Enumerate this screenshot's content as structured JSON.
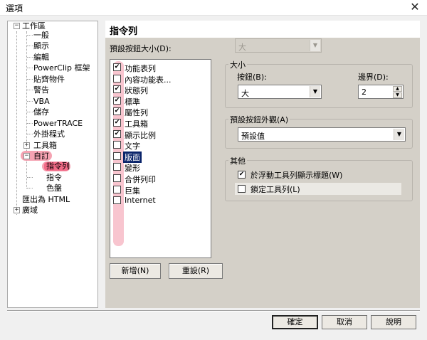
{
  "window": {
    "title": "選項",
    "close_glyph": "✕"
  },
  "tree": {
    "items": [
      {
        "label": "工作區",
        "expander": "-"
      },
      {
        "label": "一般"
      },
      {
        "label": "顯示"
      },
      {
        "label": "編輯"
      },
      {
        "label": "PowerClip 框架"
      },
      {
        "label": "貼齊物件"
      },
      {
        "label": "警告"
      },
      {
        "label": "VBA"
      },
      {
        "label": "儲存"
      },
      {
        "label": "PowerTRACE"
      },
      {
        "label": "外掛程式"
      },
      {
        "label": "工具箱",
        "expander": "+"
      },
      {
        "label": "自訂",
        "expander": "-"
      },
      {
        "label": "指令列"
      },
      {
        "label": "指令"
      },
      {
        "label": "色盤"
      },
      {
        "label": "匯出為 HTML"
      },
      {
        "label": "廣域",
        "expander": "+"
      }
    ]
  },
  "panel": {
    "title": "指令列",
    "button_size_label": "預設按鈕大小(D):",
    "button_size_value": "大",
    "commandbars": [
      {
        "label": "功能表列",
        "checked": true
      },
      {
        "label": "內容功能表...",
        "checked": false
      },
      {
        "label": "狀態列",
        "checked": true
      },
      {
        "label": "標準",
        "checked": true
      },
      {
        "label": "屬性列",
        "checked": true
      },
      {
        "label": "工具箱",
        "checked": true
      },
      {
        "label": "顯示比例",
        "checked": true
      },
      {
        "label": "文字",
        "checked": false
      },
      {
        "label": "版面",
        "checked": false
      },
      {
        "label": "變形",
        "checked": false
      },
      {
        "label": "合併列印",
        "checked": false
      },
      {
        "label": "巨集",
        "checked": false
      },
      {
        "label": "Internet",
        "checked": false
      }
    ],
    "new_button": "新增(N)",
    "reset_button": "重設(R)",
    "size_group": {
      "title": "大小",
      "button_label": "按鈕(B):",
      "button_value": "大",
      "border_label": "邊界(D):",
      "border_value": "2"
    },
    "appearance_group": {
      "title": "預設按鈕外觀(A)",
      "value": "預設值"
    },
    "other_group": {
      "title": "其他",
      "show_title_label": "於浮動工具列顯示標題(W)",
      "show_title_checked": true,
      "lock_label": "鎖定工具列(L)",
      "lock_checked": false
    }
  },
  "footer": {
    "ok": "確定",
    "cancel": "取消",
    "help": "說明"
  },
  "colors": {
    "highlight": "#f5a3b2",
    "highlight_strong": "#f26b87",
    "selection": "#0a246a",
    "panel_bg": "#d4d0c8"
  }
}
